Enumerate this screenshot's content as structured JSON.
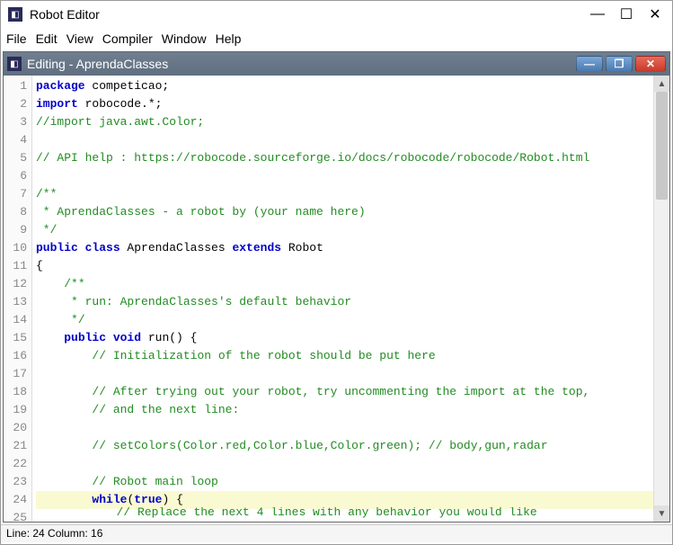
{
  "app": {
    "title": "Robot Editor"
  },
  "menu": {
    "file": "File",
    "edit": "Edit",
    "view": "View",
    "compiler": "Compiler",
    "window": "Window",
    "help": "Help"
  },
  "child": {
    "title": "Editing - AprendaClasses"
  },
  "status": {
    "text": "Line: 24 Column: 16"
  },
  "code": {
    "lines": [
      {
        "n": 1,
        "segs": [
          [
            "kw",
            "package"
          ],
          [
            "pl",
            " competicao;"
          ]
        ]
      },
      {
        "n": 2,
        "segs": [
          [
            "kw",
            "import"
          ],
          [
            "pl",
            " robocode.*;"
          ]
        ]
      },
      {
        "n": 3,
        "segs": [
          [
            "cm",
            "//import java.awt.Color;"
          ]
        ]
      },
      {
        "n": 4,
        "segs": []
      },
      {
        "n": 5,
        "segs": [
          [
            "cm",
            "// API help : https://robocode.sourceforge.io/docs/robocode/robocode/Robot.html"
          ]
        ]
      },
      {
        "n": 6,
        "segs": []
      },
      {
        "n": 7,
        "segs": [
          [
            "cm",
            "/**"
          ]
        ]
      },
      {
        "n": 8,
        "segs": [
          [
            "cm",
            " * AprendaClasses - a robot by (your name here)"
          ]
        ]
      },
      {
        "n": 9,
        "segs": [
          [
            "cm",
            " */"
          ]
        ]
      },
      {
        "n": 10,
        "segs": [
          [
            "kw",
            "public class"
          ],
          [
            "pl",
            " AprendaClasses "
          ],
          [
            "kw",
            "extends"
          ],
          [
            "pl",
            " Robot"
          ]
        ]
      },
      {
        "n": 11,
        "segs": [
          [
            "pl",
            "{"
          ]
        ]
      },
      {
        "n": 12,
        "segs": [
          [
            "pl",
            "    "
          ],
          [
            "cm",
            "/**"
          ]
        ]
      },
      {
        "n": 13,
        "segs": [
          [
            "pl",
            "    "
          ],
          [
            "cm",
            " * run: AprendaClasses's default behavior"
          ]
        ]
      },
      {
        "n": 14,
        "segs": [
          [
            "pl",
            "    "
          ],
          [
            "cm",
            " */"
          ]
        ]
      },
      {
        "n": 15,
        "segs": [
          [
            "pl",
            "    "
          ],
          [
            "kw",
            "public void"
          ],
          [
            "pl",
            " run() {"
          ]
        ]
      },
      {
        "n": 16,
        "segs": [
          [
            "pl",
            "        "
          ],
          [
            "cm",
            "// Initialization of the robot should be put here"
          ]
        ]
      },
      {
        "n": 17,
        "segs": []
      },
      {
        "n": 18,
        "segs": [
          [
            "pl",
            "        "
          ],
          [
            "cm",
            "// After trying out your robot, try uncommenting the import at the top,"
          ]
        ]
      },
      {
        "n": 19,
        "segs": [
          [
            "pl",
            "        "
          ],
          [
            "cm",
            "// and the next line:"
          ]
        ]
      },
      {
        "n": 20,
        "segs": []
      },
      {
        "n": 21,
        "segs": [
          [
            "pl",
            "        "
          ],
          [
            "cm",
            "// setColors(Color.red,Color.blue,Color.green); // body,gun,radar"
          ]
        ]
      },
      {
        "n": 22,
        "segs": []
      },
      {
        "n": 23,
        "segs": [
          [
            "pl",
            "        "
          ],
          [
            "cm",
            "// Robot main loop"
          ]
        ]
      },
      {
        "n": 24,
        "hl": true,
        "segs": [
          [
            "pl",
            "        "
          ],
          [
            "kw",
            "while"
          ],
          [
            "pl",
            "("
          ],
          [
            "kw",
            "true"
          ],
          [
            "pl",
            ") {"
          ]
        ]
      }
    ],
    "cutoff": {
      "n": 25,
      "segs": [
        [
          "pl",
          "            "
        ],
        [
          "cm",
          "// Replace the next 4 lines with any behavior you would like"
        ]
      ]
    }
  }
}
